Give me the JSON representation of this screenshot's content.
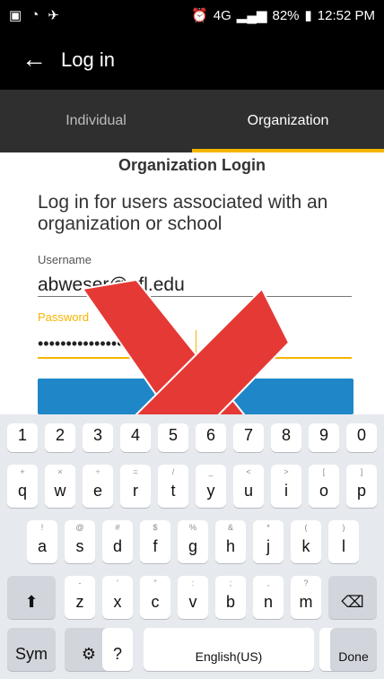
{
  "status": {
    "time": "12:52 PM",
    "battery": "82%",
    "network": "4G"
  },
  "app": {
    "back_icon": "arrow-left-icon",
    "title": "Log in"
  },
  "tabs": [
    {
      "label": "Individual"
    },
    {
      "label": "Organization"
    }
  ],
  "login": {
    "heading": "Organization Login",
    "description": "Log in for users associated with an organization or school",
    "username_label": "Username",
    "username_value": "abweser@ufl.edu",
    "password_label": "Password",
    "password_value": "•••••••••••••••••••••",
    "button_label": "Log in"
  },
  "overlay": {
    "icon": "red-x-icon",
    "color": "#e53935"
  },
  "keyboard": {
    "numbers": [
      "1",
      "2",
      "3",
      "4",
      "5",
      "6",
      "7",
      "8",
      "9",
      "0"
    ],
    "row1": [
      {
        "main": "q",
        "sub": "+"
      },
      {
        "main": "w",
        "sub": "×"
      },
      {
        "main": "e",
        "sub": "÷"
      },
      {
        "main": "r",
        "sub": "="
      },
      {
        "main": "t",
        "sub": "/"
      },
      {
        "main": "y",
        "sub": "_"
      },
      {
        "main": "u",
        "sub": "<"
      },
      {
        "main": "i",
        "sub": ">"
      },
      {
        "main": "o",
        "sub": "["
      },
      {
        "main": "p",
        "sub": "]"
      }
    ],
    "row2": [
      {
        "main": "a",
        "sub": "!"
      },
      {
        "main": "s",
        "sub": "@"
      },
      {
        "main": "d",
        "sub": "#"
      },
      {
        "main": "f",
        "sub": "$"
      },
      {
        "main": "g",
        "sub": "%"
      },
      {
        "main": "h",
        "sub": "&"
      },
      {
        "main": "j",
        "sub": "*"
      },
      {
        "main": "k",
        "sub": "("
      },
      {
        "main": "l",
        "sub": ")"
      }
    ],
    "row3": [
      {
        "main": "z",
        "sub": "-"
      },
      {
        "main": "x",
        "sub": "'"
      },
      {
        "main": "c",
        "sub": "\""
      },
      {
        "main": "v",
        "sub": ":"
      },
      {
        "main": "b",
        "sub": ";"
      },
      {
        "main": "n",
        "sub": ","
      },
      {
        "main": "m",
        "sub": "?"
      }
    ],
    "shift_icon": "shift-icon",
    "backspace_icon": "backspace-icon",
    "sym_label": "Sym",
    "settings_icon": "gear-icon",
    "question_label": "?",
    "space_label": "English(US)",
    "period_label": ".",
    "done_label": "Done"
  }
}
